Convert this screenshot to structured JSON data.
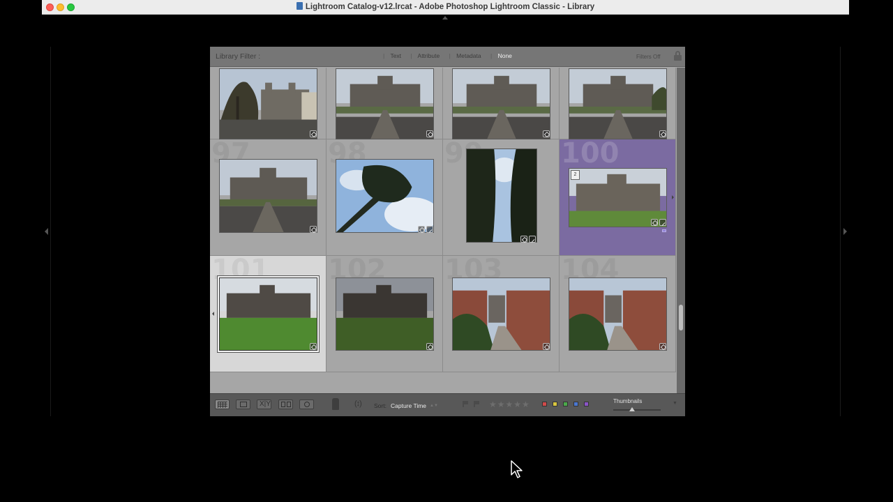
{
  "window": {
    "title": "Lightroom Catalog-v12.lrcat - Adobe Photoshop Lightroom Classic - Library"
  },
  "filter_bar": {
    "label": "Library Filter :",
    "tabs": [
      "Text",
      "Attribute",
      "Metadata",
      "None"
    ],
    "active_tab": "None",
    "filters_status": "Filters Off"
  },
  "grid": {
    "row1": [
      {
        "number": "",
        "scene": "castle-trees"
      },
      {
        "number": "",
        "scene": "castle-front"
      },
      {
        "number": "",
        "scene": "castle-front"
      },
      {
        "number": "",
        "scene": "castle-front"
      }
    ],
    "row2": [
      {
        "number": "97",
        "scene": "castle-front"
      },
      {
        "number": "98",
        "scene": "tree-sky"
      },
      {
        "number": "99",
        "scene": "trees-portrait"
      },
      {
        "number": "100",
        "scene": "castle-stack",
        "stack_count": "2",
        "selected": true
      }
    ],
    "row3": [
      {
        "number": "101",
        "scene": "castle-lawn",
        "highlight": true
      },
      {
        "number": "102",
        "scene": "castle-lawn-dark"
      },
      {
        "number": "103",
        "scene": "brick-wall"
      },
      {
        "number": "104",
        "scene": "brick-wall"
      }
    ]
  },
  "toolbar": {
    "sort_label": "Sort:",
    "sort_value": "Capture Time",
    "rating_stars": "★★★★★",
    "color_labels": [
      "#d04a4a",
      "#d8c640",
      "#4aa84a",
      "#4a76cf",
      "#8a54c6"
    ],
    "thumbnails_label": "Thumbnails",
    "thumbnail_size": 0.4,
    "view_modes": [
      "grid-view-icon",
      "loupe-view-icon",
      "compare-view-icon",
      "survey-view-icon",
      "people-view-icon"
    ]
  }
}
